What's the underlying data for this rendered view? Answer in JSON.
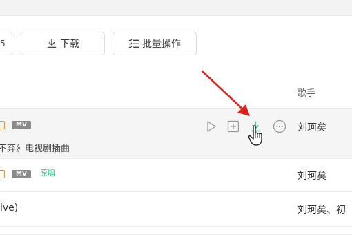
{
  "toolbar": {
    "download_label": "下载",
    "batch_label": "批量操作",
    "batch_icon_text": "ꕥ☰"
  },
  "table": {
    "header_singer": "歌手",
    "rows": [
      {
        "tags": [
          "",
          "MV"
        ],
        "subtitle": "不弃》电视剧插曲",
        "singer": "刘珂矣"
      },
      {
        "tags": [
          "",
          "MV",
          "原唱"
        ],
        "singer": "刘珂矣"
      },
      {
        "title": "ive)",
        "singer": "刘珂矣、初"
      }
    ]
  },
  "colors": {
    "accent_green": "#31c27c",
    "arrow_red": "#e02020",
    "tag_orange": "#e8924a",
    "mv_gray": "#8a8a8a"
  }
}
